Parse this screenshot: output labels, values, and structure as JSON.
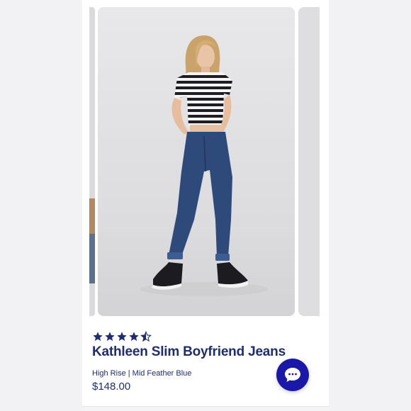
{
  "product": {
    "rating_value": 4.5,
    "rating_max": 5,
    "title": "Kathleen Slim Boyfriend Jeans",
    "subtitle": "High Rise | Mid Feather Blue",
    "price": "$148.00"
  },
  "carousel": {
    "main_image_icon": "model-in-jeans-photo"
  },
  "chat": {
    "icon": "chat-bubble-icon"
  },
  "colors": {
    "brand_navy": "#1f2d6e",
    "chat_blue": "#1a18a8",
    "photo_bg": "#e3e3e5",
    "denim": "#2e4a7a"
  }
}
